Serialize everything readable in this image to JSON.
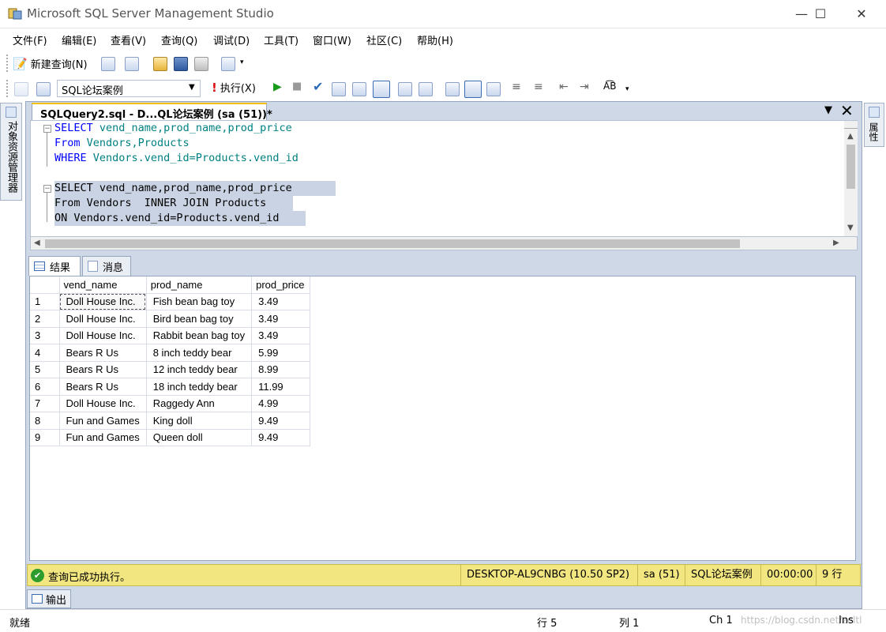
{
  "window": {
    "title": "Microsoft SQL Server Management Studio",
    "controls": {
      "minimize": "—",
      "maximize": "☐",
      "close": "✕"
    }
  },
  "menu": [
    "文件(F)",
    "编辑(E)",
    "查看(V)",
    "查询(Q)",
    "调试(D)",
    "工具(T)",
    "窗口(W)",
    "社区(C)",
    "帮助(H)"
  ],
  "toolbar1": {
    "new_query": "新建查询(N)"
  },
  "toolbar2": {
    "database": "SQL论坛案例",
    "execute": "执行(X)"
  },
  "left_dock": {
    "label": "对象资源管理器"
  },
  "right_dock": {
    "label": "属性"
  },
  "document": {
    "tab_label": "SQLQuery2.sql - D...QL论坛案例 (sa (51))*",
    "dropdown": "▼",
    "close": "✕"
  },
  "editor": {
    "lines": [
      {
        "kw": "SELECT",
        "rest": " vend_name,prod_name,prod_price"
      },
      {
        "kw": "From",
        "rest": " Vendors,Products"
      },
      {
        "kw": "WHERE",
        "rest": " Vendors.vend_id=Products.vend_id"
      },
      {
        "kw": "",
        "rest": ""
      },
      {
        "kw": "SELECT",
        "rest": " vend_name,prod_name,prod_price"
      },
      {
        "kw": "From",
        "rest": " Vendors  INNER JOIN Products"
      },
      {
        "kw": "ON",
        "rest": " Vendors.vend_id=Products.vend_id"
      }
    ]
  },
  "results_tabs": {
    "results": "结果",
    "messages": "消息"
  },
  "grid": {
    "columns": [
      "vend_name",
      "prod_name",
      "prod_price"
    ],
    "rows": [
      [
        "1",
        "Doll House Inc.",
        "Fish bean bag toy",
        "3.49"
      ],
      [
        "2",
        "Doll House Inc.",
        "Bird bean bag toy",
        "3.49"
      ],
      [
        "3",
        "Doll House Inc.",
        "Rabbit bean bag toy",
        "3.49"
      ],
      [
        "4",
        "Bears R Us",
        "8 inch teddy bear",
        "5.99"
      ],
      [
        "5",
        "Bears R Us",
        "12 inch teddy bear",
        "8.99"
      ],
      [
        "6",
        "Bears R Us",
        "18 inch teddy bear",
        "11.99"
      ],
      [
        "7",
        "Doll House Inc.",
        "Raggedy Ann",
        "4.99"
      ],
      [
        "8",
        "Fun and Games",
        "King doll",
        "9.49"
      ],
      [
        "9",
        "Fun and Games",
        "Queen doll",
        "9.49"
      ]
    ]
  },
  "query_status": {
    "message": "查询已成功执行。",
    "server": "DESKTOP-AL9CNBG (10.50 SP2)",
    "user": "sa (51)",
    "database": "SQL论坛案例",
    "elapsed": "00:00:00",
    "rows": "9 行"
  },
  "output_tab": {
    "label": "输出"
  },
  "statusbar": {
    "ready": "就绪",
    "line": "行 5",
    "col": "列 1",
    "ch": "Ch 1",
    "ins": "Ins",
    "watermark": "https://blog.csdn.net/zeltl"
  },
  "colors": {
    "keyword": "#0000ff",
    "identifier": "#008080",
    "status_bg": "#f2e680",
    "tab_accent": "#f5c000"
  }
}
